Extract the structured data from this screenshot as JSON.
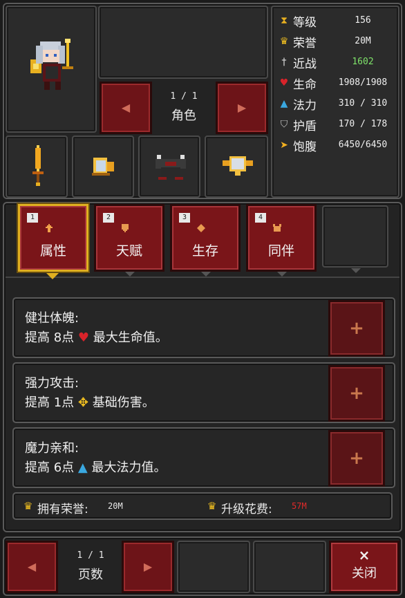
{
  "character": {
    "page_counter": "1 / 1",
    "page_label": "角色"
  },
  "stats": [
    {
      "icon": "hourglass-icon",
      "label": "等级",
      "value": "156",
      "color": "#f0f0f0"
    },
    {
      "icon": "crown-icon",
      "label": "荣誉",
      "value": "20M",
      "color": "#f0f0f0"
    },
    {
      "icon": "sword-icon",
      "label": "近战",
      "value": "1602",
      "color": "#7fe36a"
    },
    {
      "icon": "heart-icon",
      "label": "生命",
      "value": "1908/1908",
      "color": "#f0f0f0"
    },
    {
      "icon": "potion-icon",
      "label": "法力",
      "value": "310 / 310",
      "color": "#f0f0f0"
    },
    {
      "icon": "shield-icon",
      "label": "护盾",
      "value": "170 / 178",
      "color": "#f0f0f0"
    },
    {
      "icon": "hunger-icon",
      "label": "饱腹",
      "value": "6450/6450",
      "color": "#f0f0f0"
    }
  ],
  "tabs": [
    {
      "num": "1",
      "label": "属性",
      "icon": "up-arrow-icon",
      "selected": true
    },
    {
      "num": "2",
      "label": "天赋",
      "icon": "shield-icon"
    },
    {
      "num": "3",
      "label": "生存",
      "icon": "diamond-icon"
    },
    {
      "num": "4",
      "label": "同伴",
      "icon": "pet-icon"
    }
  ],
  "skills": [
    {
      "name": "健壮体魄:",
      "desc_pre": "提高 8点",
      "desc_icon": "heart-icon",
      "desc_post": "最大生命值。"
    },
    {
      "name": "强力攻击:",
      "desc_pre": "提高 1点",
      "desc_icon": "damage-icon",
      "desc_post": "基础伤害。"
    },
    {
      "name": "魔力亲和:",
      "desc_pre": "提高 6点",
      "desc_icon": "potion-icon",
      "desc_post": "最大法力值。"
    }
  ],
  "honor": {
    "owned_label": "拥有荣誉:",
    "owned_value": "20M",
    "cost_label": "升级花费:",
    "cost_value": "57M",
    "cost_color": "#e02a2a"
  },
  "footer": {
    "page_counter": "1 / 1",
    "page_label": "页数",
    "close_label": "关闭",
    "close_icon": "×"
  }
}
